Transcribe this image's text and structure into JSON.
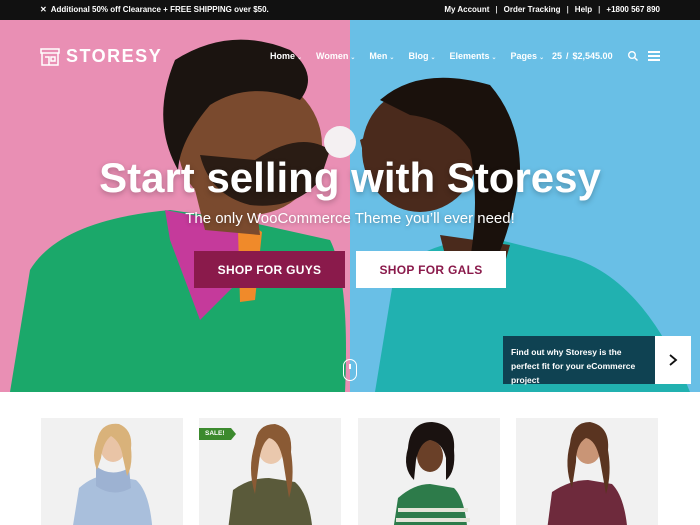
{
  "topbar": {
    "promo": "Additional 50% off Clearance + FREE SHIPPING over $50.",
    "links": [
      "My Account",
      "Order Tracking",
      "Help",
      "+1800 567 890"
    ]
  },
  "header": {
    "logo": "STORESY",
    "nav": [
      "Home",
      "Women",
      "Men",
      "Blog",
      "Elements",
      "Pages"
    ],
    "cart_count": "25",
    "cart_separator": "/",
    "cart_total": "$2,545.00"
  },
  "hero": {
    "title": "Start selling with Storesy",
    "subtitle": "The only WooCommerce Theme you’ll ever need!",
    "button_guys": "SHOP FOR GUYS",
    "button_gals": "SHOP FOR GALS",
    "promo_text": "Find out why Storesy is the perfect fit for your eCommerce project",
    "left_color": "#e98fb4",
    "right_color": "#69bfe6",
    "accent_color": "#8a1a4b"
  },
  "products": {
    "sale_badge": "SALE!"
  },
  "icons": {
    "search": "search-icon",
    "menu": "hamburger-menu-icon",
    "arrow": "chevron-right-icon",
    "logo": "storefront-icon"
  }
}
